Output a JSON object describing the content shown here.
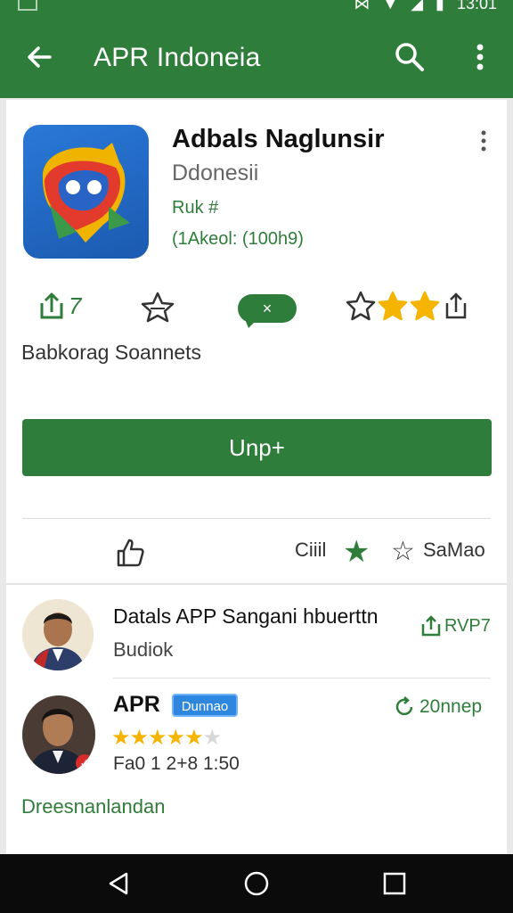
{
  "status_bar": {
    "time": "13:01",
    "icons": [
      "signal-icon",
      "vibrate-icon",
      "wifi-icon",
      "cell-icon",
      "battery-icon"
    ]
  },
  "app_bar": {
    "title": "APR Indoneia",
    "icons": [
      "back-arrow-icon",
      "search-icon",
      "more-vert-icon"
    ]
  },
  "app": {
    "name": "Adbals Naglunsir",
    "developer": "Ddonesii",
    "rank": "Ruk #",
    "stat": "(1Akeol: (100h9)"
  },
  "actions": {
    "share_label": "7",
    "chip_label": "×",
    "stars_filled": 2,
    "stars_total": 3
  },
  "section_label": "Babkorag Soannets",
  "install_button": "Unp+",
  "rating_row": {
    "count_label": "Ciiil",
    "more_label": "SaMao"
  },
  "reviews": [
    {
      "title": "Datals APP Sangani hbuerttn",
      "subtitle": "Budiok",
      "action_label": "RVP7"
    },
    {
      "name": "APR",
      "badge": "Dunnao",
      "rating": 5,
      "rating_max": 6,
      "meta": "Fa0 1 2+8 1:50",
      "time": "20nnep"
    }
  ],
  "link_text": "Dreesnanlandan",
  "colors": {
    "primary": "#2f7d3a",
    "star": "#f5b400",
    "badge": "#2e86de"
  }
}
